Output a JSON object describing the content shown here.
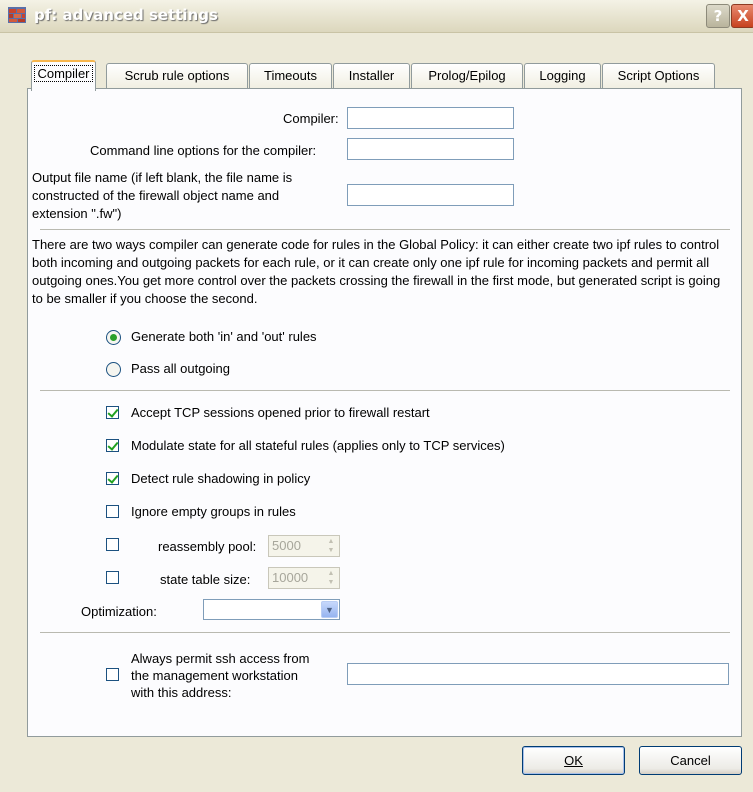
{
  "window": {
    "title": "pf: advanced settings",
    "help_glyph": "?",
    "close_glyph": "X"
  },
  "tabs": [
    {
      "label": "Compiler",
      "active": true
    },
    {
      "label": "Scrub rule options",
      "active": false
    },
    {
      "label": "Timeouts",
      "active": false
    },
    {
      "label": "Installer",
      "active": false
    },
    {
      "label": "Prolog/Epilog",
      "active": false
    },
    {
      "label": "Logging",
      "active": false
    },
    {
      "label": "Script Options",
      "active": false
    }
  ],
  "compiler": {
    "compiler_label": "Compiler:",
    "compiler_value": "",
    "cmdline_label": "Command line options for the compiler:",
    "cmdline_value": "",
    "output_label_1": "Output file name (if left blank, the file name is",
    "output_label_2": "constructed of the firewall object name and",
    "output_label_3": "extension \".fw\")",
    "output_value": ""
  },
  "description": "There are two ways compiler can generate code for rules in the Global Policy: it can either create two ipf rules to control both incoming and outgoing packets for each rule, or it can create only one ipf rule for incoming packets and permit all outgoing ones.You get more control over the packets crossing the firewall in the first mode, but generated script is going to be smaller if you choose the second.",
  "radios": {
    "both_label": "Generate both 'in' and 'out' rules",
    "both_selected": true,
    "pass_label": "Pass all outgoing",
    "pass_selected": false
  },
  "checkboxes": {
    "accept_tcp": {
      "label": "Accept TCP sessions opened prior to firewall restart",
      "checked": true
    },
    "modulate": {
      "label": "Modulate state for all stateful rules (applies only to TCP services)",
      "checked": true
    },
    "shadowing": {
      "label": "Detect rule shadowing in policy",
      "checked": true
    },
    "ignore_empty": {
      "label": "Ignore empty groups in rules",
      "checked": false
    },
    "reassembly": {
      "label": "reassembly pool:",
      "checked": false,
      "value": "5000"
    },
    "state_table": {
      "label": "state table size:",
      "checked": false,
      "value": "10000"
    }
  },
  "optimization": {
    "label": "Optimization:",
    "value": ""
  },
  "ssh": {
    "label_1": "Always permit ssh access from",
    "label_2": "the management workstation",
    "label_3": "with this address:",
    "checked": false,
    "value": ""
  },
  "buttons": {
    "ok": "OK",
    "cancel": "Cancel"
  }
}
